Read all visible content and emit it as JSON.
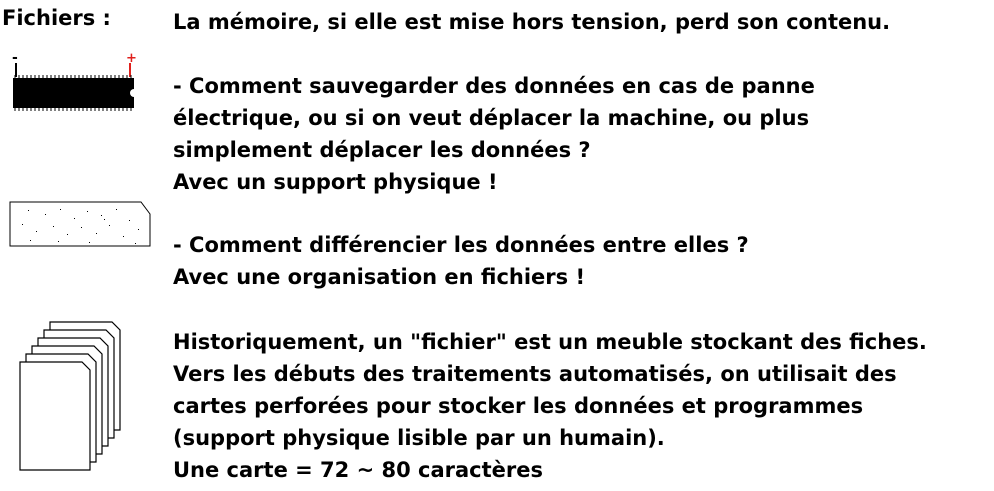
{
  "heading": "Fichiers :",
  "icons": {
    "chip": "memory-chip-icon",
    "card": "storage-card-icon",
    "stack": "file-stack-icon",
    "chip_minus": "-",
    "chip_plus": "+"
  },
  "paragraphs": {
    "p1": [
      "La mémoire, si elle est mise hors tension, perd son contenu."
    ],
    "p2": [
      "- Comment sauvegarder des données en cas de panne",
      "électrique, ou si on veut déplacer la machine, ou plus",
      "simplement déplacer les données ?",
      "Avec un support physique !"
    ],
    "p3": [
      "- Comment différencier les données entre elles ?",
      "Avec une organisation en fichiers !"
    ],
    "p4": [
      "Historiquement, un \"fichier\" est un meuble stockant des fiches.",
      "Vers les débuts des traitements automatisés, on utilisait des",
      "cartes perforées pour stocker les données et programmes",
      "(support physique lisible par un humain).",
      "Une carte = 72 ~ 80 caractères"
    ]
  },
  "colors": {
    "text": "#000000",
    "plus_sign": "#e0201c",
    "background": "#ffffff"
  }
}
